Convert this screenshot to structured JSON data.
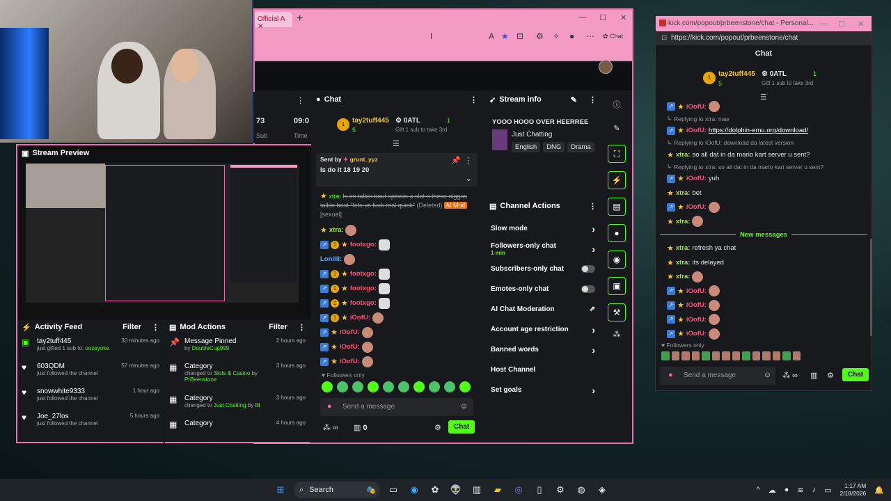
{
  "browser": {
    "tab_label": "Official A",
    "address_icons": [
      "A",
      "★",
      "⊡",
      "⚙",
      "✧",
      "👤",
      "⋯"
    ],
    "copilot_label": "Chat"
  },
  "stream_preview": {
    "title": "Stream Preview"
  },
  "partial_stats": {
    "v1": "73",
    "v2": "09:0",
    "l1": "Sub",
    "l2": "Time"
  },
  "activity_feed": {
    "title": "Activity Feed",
    "filter": "Filter",
    "items": [
      {
        "name": "tay2tuff445",
        "sub": "just gifted 1 sub to:",
        "target": "oozeyoke",
        "time": "30 minutes ago",
        "icon": "gift-icon"
      },
      {
        "name": "603QDM",
        "sub": "just followed the channel",
        "time": "57 minutes ago",
        "icon": "heart-icon"
      },
      {
        "name": "snowwhite9333",
        "sub": "just followed the channel",
        "time": "1 hour ago",
        "icon": "heart-icon"
      },
      {
        "name": "Joe_27los",
        "sub": "just followed the channel",
        "time": "5 hours ago",
        "icon": "heart-icon"
      }
    ]
  },
  "mod_actions": {
    "title": "Mod Actions",
    "filter": "Filter",
    "items": [
      {
        "title": "Message Pinned",
        "sub": "by",
        "who": "DoubleCup999",
        "time": "2 hours ago"
      },
      {
        "title": "Category",
        "sub": "changed to",
        "what": "Slots & Casino",
        "by": "by",
        "who": "PrBeenstone",
        "time": "3 hours ago"
      },
      {
        "title": "Category",
        "sub": "changed to",
        "what": "Just Chatting",
        "by": "by",
        "who": "llll",
        "time": "3 hours ago"
      },
      {
        "title": "Category",
        "time": "4 hours ago"
      }
    ]
  },
  "chat": {
    "title": "Chat",
    "top_user": "tay2tuff445",
    "top_count": "5",
    "oatl": "0ATL",
    "oatl_count": "1",
    "gift": "Gift 1 sub to take 3rd",
    "pinned_label": "Sent by",
    "pinned_user": "grunt_yyz",
    "pinned_text": "Is do it 18 19 20",
    "deleted_user": "xtra:",
    "deleted_text": "Is im talkin bout spinnin a slot n these niggas talkin bout \"lets us fuck real quick\"",
    "deleted_tag": "(Deleted)",
    "ai_mod": "AI Mod",
    "sexual": "[sexual]",
    "lines": [
      {
        "user": "xtra:",
        "cls": "green",
        "badges": "star"
      },
      {
        "user": "footxgo:",
        "cls": "pink",
        "badges": "all"
      },
      {
        "user": "Lonilll:",
        "cls": "blue",
        "badges": "none"
      },
      {
        "user": "footxgo:",
        "cls": "pink",
        "badges": "all"
      },
      {
        "user": "footxgo:",
        "cls": "pink",
        "badges": "all"
      },
      {
        "user": "footxgo:",
        "cls": "pink",
        "badges": "all"
      },
      {
        "user": "iOofU:",
        "cls": "pink",
        "badges": "all"
      },
      {
        "user": "iOofU:",
        "cls": "pink",
        "badges": "bs"
      },
      {
        "user": "iOofU:",
        "cls": "pink",
        "badges": "bs"
      },
      {
        "user": "iOofU:",
        "cls": "pink",
        "badges": "bs"
      }
    ],
    "followers_only": "Followers only",
    "placeholder": "Send a message",
    "count": "0",
    "send": "Chat"
  },
  "stream_info": {
    "title": "Stream info",
    "headline": "YOOO HOOO OVER HEERREE",
    "category": "Just Chatting",
    "tags": [
      "English",
      "DNG",
      "Drama"
    ]
  },
  "channel_actions": {
    "title": "Channel Actions",
    "rows": [
      {
        "label": "Slow mode",
        "ctrl": "chevron"
      },
      {
        "label": "Followers-only chat",
        "sub": "1 min",
        "ctrl": "chevron"
      },
      {
        "label": "Subscribers-only chat",
        "ctrl": "toggle"
      },
      {
        "label": "Emotes-only chat",
        "ctrl": "toggle"
      },
      {
        "label": "AI Chat Moderation",
        "ctrl": "ext"
      },
      {
        "label": "Account age restriction",
        "ctrl": "chevron"
      },
      {
        "label": "Banned words",
        "ctrl": "chevron"
      },
      {
        "label": "Host Channel",
        "ctrl": "none"
      },
      {
        "label": "Set goals",
        "ctrl": "chevron"
      }
    ]
  },
  "popout": {
    "window_title": "kick.com/popout/prbeenstone/chat - Personal...",
    "url": "https://kick.com/popout/prbeenstone/chat",
    "title": "Chat",
    "top_user": "tay2tuff445",
    "top_count": "5",
    "oatl": "0ATL",
    "oatl_count": "1",
    "gift": "Gift 1 sub to take 3rd",
    "lines": [
      {
        "type": "msg",
        "user": "iOofU:",
        "text": ""
      },
      {
        "type": "reply",
        "text": "Replying to xtra: naw"
      },
      {
        "type": "msg",
        "user": "iOofU:",
        "text": "https://dolphin-emu.org/download/",
        "link": true
      },
      {
        "type": "reply",
        "text": "Replying to iOofU: download da latest version"
      },
      {
        "type": "msg",
        "user": "xtra:",
        "text": "so all dat in da mario kart server u sent?",
        "green": true
      },
      {
        "type": "reply",
        "text": "Replying to xtra: so all dat in da mario kart server u sent?"
      },
      {
        "type": "msg",
        "user": "iOofU:",
        "text": "yuh"
      },
      {
        "type": "msg",
        "user": "xtra:",
        "text": "bet",
        "green": true
      },
      {
        "type": "msg",
        "user": "iOofU:",
        "text": ""
      },
      {
        "type": "msg",
        "user": "xtra:",
        "text": "",
        "green": true
      },
      {
        "type": "divider",
        "text": "New messages"
      },
      {
        "type": "msg",
        "user": "xtra:",
        "text": "refresh ya chat",
        "green": true
      },
      {
        "type": "msg",
        "user": "xtra:",
        "text": "its delayed",
        "green": true
      },
      {
        "type": "msg",
        "user": "xtra:",
        "text": "",
        "green": true
      },
      {
        "type": "msg",
        "user": "iOofU:",
        "text": ""
      },
      {
        "type": "msg",
        "user": "iOofU:",
        "text": ""
      },
      {
        "type": "msg",
        "user": "iOofU:",
        "text": ""
      },
      {
        "type": "msg",
        "user": "iOofU:",
        "text": ""
      }
    ],
    "followers_only": "Followers only",
    "placeholder": "Send a message",
    "send": "Chat"
  },
  "taskbar": {
    "search": "Search",
    "time": "1:17 AM",
    "date": "2/18/2026"
  }
}
